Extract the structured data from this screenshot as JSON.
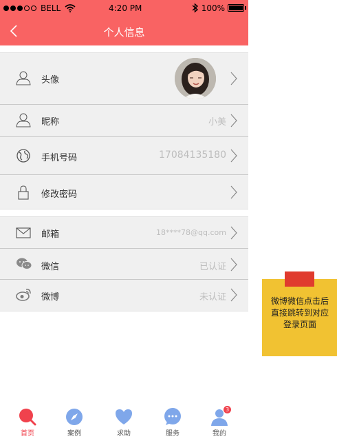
{
  "status_bar": {
    "carrier": "BELL",
    "time": "4:20 PM",
    "battery": "100%"
  },
  "header": {
    "title": "个人信息"
  },
  "profile": {
    "rows": [
      {
        "label": "头像",
        "value": ""
      },
      {
        "label": "昵称",
        "value": "小美"
      },
      {
        "label": "手机号码",
        "value": "17084135180"
      },
      {
        "label": "修改密码",
        "value": ""
      }
    ]
  },
  "accounts": {
    "rows": [
      {
        "label": "邮箱",
        "value": "18****78@qq.com"
      },
      {
        "label": "微信",
        "value": "已认证"
      },
      {
        "label": "微博",
        "value": "未认证"
      }
    ]
  },
  "note": {
    "text": "微博微信点击后直接跳转到对应登录页面"
  },
  "tabbar": {
    "tabs": [
      {
        "label": "首页",
        "icon": "search-icon"
      },
      {
        "label": "案例",
        "icon": "compass-icon"
      },
      {
        "label": "求助",
        "icon": "heart-icon"
      },
      {
        "label": "服务",
        "icon": "chat-icon"
      },
      {
        "label": "我的",
        "icon": "user-icon",
        "badge": "3"
      }
    ]
  },
  "colors": {
    "accent": "#f96363",
    "active_tab": "#f0424d",
    "note": "#f1c232",
    "pin": "#e03b2e",
    "tab_icon": "#7fa7ea"
  }
}
